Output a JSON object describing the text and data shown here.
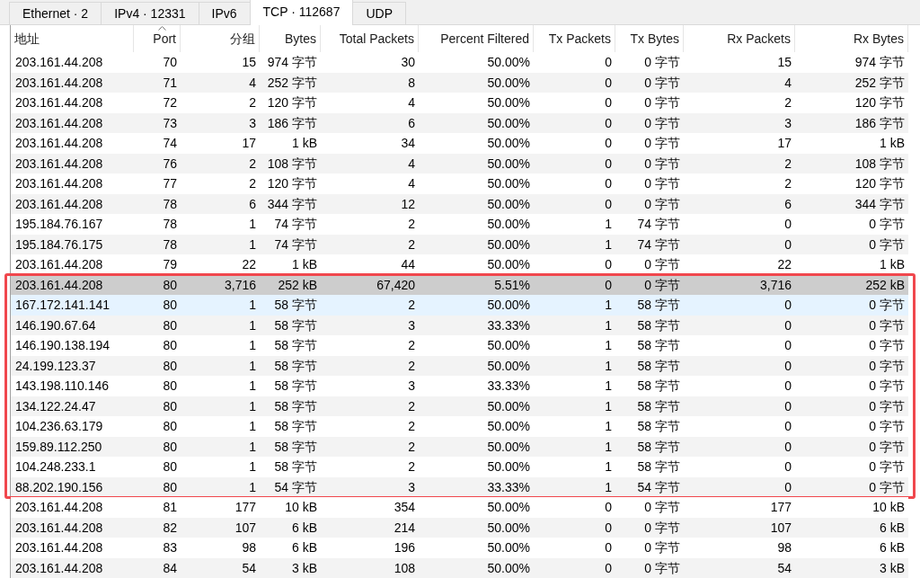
{
  "tabs": [
    {
      "label": "Ethernet · 2",
      "selected": false
    },
    {
      "label": "IPv4 · 12331",
      "selected": false
    },
    {
      "label": "IPv6",
      "selected": false
    },
    {
      "label": "TCP · 112687",
      "selected": true
    },
    {
      "label": "UDP",
      "selected": false
    }
  ],
  "table": {
    "columns": [
      {
        "label": "地址",
        "sorted": false
      },
      {
        "label": "Port",
        "sorted": true
      },
      {
        "label": "分组",
        "sorted": false
      },
      {
        "label": "Bytes",
        "sorted": false
      },
      {
        "label": "Total Packets",
        "sorted": false
      },
      {
        "label": "Percent Filtered",
        "sorted": false
      },
      {
        "label": "Tx Packets",
        "sorted": false
      },
      {
        "label": "Tx Bytes",
        "sorted": false
      },
      {
        "label": "Rx Packets",
        "sorted": false
      },
      {
        "label": "Rx Bytes",
        "sorted": false
      }
    ],
    "row_groups": [
      {
        "outlined": false,
        "rows": [
          {
            "cells": [
              "203.161.44.208",
              "70",
              "15",
              "974 字节",
              "30",
              "50.00%",
              "0",
              "0 字节",
              "15",
              "974 字节"
            ],
            "selected": false,
            "hovered": false
          },
          {
            "cells": [
              "203.161.44.208",
              "71",
              "4",
              "252 字节",
              "8",
              "50.00%",
              "0",
              "0 字节",
              "4",
              "252 字节"
            ],
            "selected": false,
            "hovered": false
          },
          {
            "cells": [
              "203.161.44.208",
              "72",
              "2",
              "120 字节",
              "4",
              "50.00%",
              "0",
              "0 字节",
              "2",
              "120 字节"
            ],
            "selected": false,
            "hovered": false
          },
          {
            "cells": [
              "203.161.44.208",
              "73",
              "3",
              "186 字节",
              "6",
              "50.00%",
              "0",
              "0 字节",
              "3",
              "186 字节"
            ],
            "selected": false,
            "hovered": false
          },
          {
            "cells": [
              "203.161.44.208",
              "74",
              "17",
              "1 kB",
              "34",
              "50.00%",
              "0",
              "0 字节",
              "17",
              "1 kB"
            ],
            "selected": false,
            "hovered": false
          },
          {
            "cells": [
              "203.161.44.208",
              "76",
              "2",
              "108 字节",
              "4",
              "50.00%",
              "0",
              "0 字节",
              "2",
              "108 字节"
            ],
            "selected": false,
            "hovered": false
          },
          {
            "cells": [
              "203.161.44.208",
              "77",
              "2",
              "120 字节",
              "4",
              "50.00%",
              "0",
              "0 字节",
              "2",
              "120 字节"
            ],
            "selected": false,
            "hovered": false
          },
          {
            "cells": [
              "203.161.44.208",
              "78",
              "6",
              "344 字节",
              "12",
              "50.00%",
              "0",
              "0 字节",
              "6",
              "344 字节"
            ],
            "selected": false,
            "hovered": false
          },
          {
            "cells": [
              "195.184.76.167",
              "78",
              "1",
              "74 字节",
              "2",
              "50.00%",
              "1",
              "74 字节",
              "0",
              "0 字节"
            ],
            "selected": false,
            "hovered": false
          },
          {
            "cells": [
              "195.184.76.175",
              "78",
              "1",
              "74 字节",
              "2",
              "50.00%",
              "1",
              "74 字节",
              "0",
              "0 字节"
            ],
            "selected": false,
            "hovered": false
          },
          {
            "cells": [
              "203.161.44.208",
              "79",
              "22",
              "1 kB",
              "44",
              "50.00%",
              "0",
              "0 字节",
              "22",
              "1 kB"
            ],
            "selected": false,
            "hovered": false
          }
        ]
      },
      {
        "outlined": true,
        "rows": [
          {
            "cells": [
              "203.161.44.208",
              "80",
              "3,716",
              "252 kB",
              "67,420",
              "5.51%",
              "0",
              "0 字节",
              "3,716",
              "252 kB"
            ],
            "selected": true,
            "hovered": false
          },
          {
            "cells": [
              "167.172.141.141",
              "80",
              "1",
              "58 字节",
              "2",
              "50.00%",
              "1",
              "58 字节",
              "0",
              "0 字节"
            ],
            "selected": false,
            "hovered": true
          },
          {
            "cells": [
              "146.190.67.64",
              "80",
              "1",
              "58 字节",
              "3",
              "33.33%",
              "1",
              "58 字节",
              "0",
              "0 字节"
            ],
            "selected": false,
            "hovered": false
          },
          {
            "cells": [
              "146.190.138.194",
              "80",
              "1",
              "58 字节",
              "2",
              "50.00%",
              "1",
              "58 字节",
              "0",
              "0 字节"
            ],
            "selected": false,
            "hovered": false
          },
          {
            "cells": [
              "24.199.123.37",
              "80",
              "1",
              "58 字节",
              "2",
              "50.00%",
              "1",
              "58 字节",
              "0",
              "0 字节"
            ],
            "selected": false,
            "hovered": false
          },
          {
            "cells": [
              "143.198.110.146",
              "80",
              "1",
              "58 字节",
              "3",
              "33.33%",
              "1",
              "58 字节",
              "0",
              "0 字节"
            ],
            "selected": false,
            "hovered": false
          },
          {
            "cells": [
              "134.122.24.47",
              "80",
              "1",
              "58 字节",
              "2",
              "50.00%",
              "1",
              "58 字节",
              "0",
              "0 字节"
            ],
            "selected": false,
            "hovered": false
          },
          {
            "cells": [
              "104.236.63.179",
              "80",
              "1",
              "58 字节",
              "2",
              "50.00%",
              "1",
              "58 字节",
              "0",
              "0 字节"
            ],
            "selected": false,
            "hovered": false
          },
          {
            "cells": [
              "159.89.112.250",
              "80",
              "1",
              "58 字节",
              "2",
              "50.00%",
              "1",
              "58 字节",
              "0",
              "0 字节"
            ],
            "selected": false,
            "hovered": false
          },
          {
            "cells": [
              "104.248.233.1",
              "80",
              "1",
              "58 字节",
              "2",
              "50.00%",
              "1",
              "58 字节",
              "0",
              "0 字节"
            ],
            "selected": false,
            "hovered": false
          },
          {
            "cells": [
              "88.202.190.156",
              "80",
              "1",
              "54 字节",
              "3",
              "33.33%",
              "1",
              "54 字节",
              "0",
              "0 字节"
            ],
            "selected": false,
            "hovered": false
          }
        ]
      },
      {
        "outlined": false,
        "rows": [
          {
            "cells": [
              "203.161.44.208",
              "81",
              "177",
              "10 kB",
              "354",
              "50.00%",
              "0",
              "0 字节",
              "177",
              "10 kB"
            ],
            "selected": false,
            "hovered": false
          },
          {
            "cells": [
              "203.161.44.208",
              "82",
              "107",
              "6 kB",
              "214",
              "50.00%",
              "0",
              "0 字节",
              "107",
              "6 kB"
            ],
            "selected": false,
            "hovered": false
          },
          {
            "cells": [
              "203.161.44.208",
              "83",
              "98",
              "6 kB",
              "196",
              "50.00%",
              "0",
              "0 字节",
              "98",
              "6 kB"
            ],
            "selected": false,
            "hovered": false
          },
          {
            "cells": [
              "203.161.44.208",
              "84",
              "54",
              "3 kB",
              "108",
              "50.00%",
              "0",
              "0 字节",
              "54",
              "3 kB"
            ],
            "selected": false,
            "hovered": false
          }
        ]
      }
    ]
  }
}
